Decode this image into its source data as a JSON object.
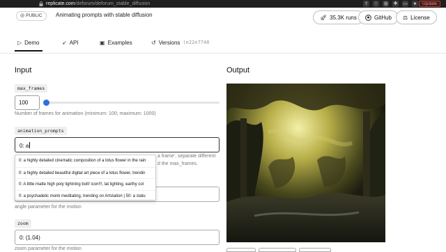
{
  "browser": {
    "url_host": "replicate.com",
    "url_path": "/deforum/deforum_stable_diffusion",
    "update_label": "Update"
  },
  "header": {
    "visibility_badge": "PUBLIC",
    "description": "Animating prompts with stable diffusion",
    "runs_label": "35.3K runs",
    "github_label": "GitHub",
    "license_label": "License"
  },
  "tabs": [
    {
      "label": "Demo",
      "icon": "play-icon",
      "active": true
    },
    {
      "label": "API",
      "icon": "rocket-icon"
    },
    {
      "label": "Examples",
      "icon": "image-icon"
    },
    {
      "label": "Versions",
      "icon": "history-icon",
      "hash": "(e22e7748"
    }
  ],
  "input": {
    "heading": "Input",
    "max_frames": {
      "label": "max_frames",
      "value": "100",
      "help": "Number of frames for animation (minimum: 100; maximum: 1000)",
      "slider_fraction": 0.0
    },
    "animation_prompts": {
      "label": "animation_prompts",
      "value": "0: a",
      "help_behind_1": "a frame', separate different",
      "help_behind_2": "d the max_frames.",
      "suggestions": [
        "0: a highly detailed cinematic composition of a lotus flower in the rain",
        "0: a highly detailed beautiful digital art piece of a lotus flower, trendin",
        "0: A little matte high poly lightning bolt! icon!!!, lat lighting, earthy col",
        "0: a psychadelic monk meditating, trending on Artstation | 50: a statu"
      ]
    },
    "angle": {
      "help": "angle parameter for the motion"
    },
    "zoom": {
      "label": "zoom",
      "value": "0: (1.04)",
      "help": "zoom parameter for the motion"
    }
  },
  "output": {
    "heading": "Output"
  },
  "colors": {
    "accent": "#2f6fdc",
    "update_border": "#c0392b"
  }
}
